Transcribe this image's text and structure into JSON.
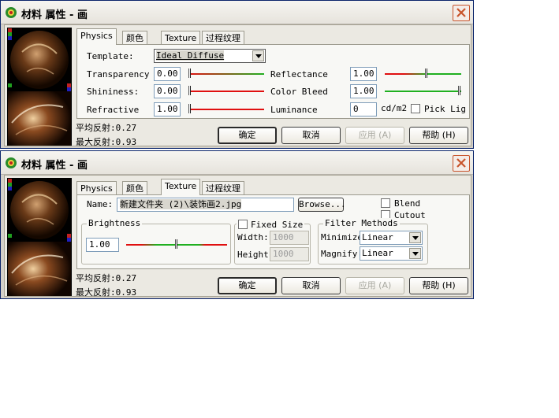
{
  "window_title": "材料  属性 - 画",
  "close_label": "×",
  "tabs": [
    "Physics",
    "颜色",
    "Texture",
    "过程纹理"
  ],
  "physics": {
    "template_label": "Template:",
    "template_value": "Ideal Diffuse",
    "transparency_label": "Transparency",
    "transparency_value": "0.00",
    "shininess_label": "Shininess:",
    "shininess_value": "0.00",
    "refractive_label": "Refractive",
    "refractive_value": "1.00",
    "reflectance_label": "Reflectance",
    "reflectance_value": "1.00",
    "color_bleed_label": "Color Bleed",
    "color_bleed_value": "1.00",
    "luminance_label": "Luminance",
    "luminance_value": "0",
    "luminance_unit": "cd/m2",
    "pick_light_label": "Pick Lig",
    "slider_levels": {
      "transparency": 0.0,
      "shininess": 0.0,
      "refractive": 0.0,
      "reflectance": 0.55,
      "color_bleed": 1.0
    }
  },
  "texture": {
    "name_label": "Name:",
    "name_value": "新建文件夹 (2)\\装饰画2.jpg",
    "browse_label": "Browse...",
    "blend_label": "Blend",
    "cutout_label": "Cutout",
    "brightness_title": "Brightness",
    "brightness_value": "1.00",
    "brightness_level": 0.5,
    "fixed_size_label": "Fixed Size",
    "width_label": "Width:",
    "width_value": "1000",
    "height_label": "Height",
    "height_value": "1000",
    "filter_title": "Filter Methods",
    "minimize_label": "Minimize",
    "minimize_value": "Linear",
    "magnify_label": "Magnify",
    "magnify_value": "Linear"
  },
  "stats": {
    "avg_reflect": "平均反射:0.27",
    "max_reflect": "最大反射:0.93"
  },
  "buttons": {
    "ok": "确定",
    "cancel": "取消",
    "apply": "应用 (A)",
    "help": "帮助 (H)"
  },
  "colors": {
    "accent": "#0a246a",
    "slider_red": "#e01010",
    "slider_green": "#20b020",
    "close_red": "#c8542c"
  }
}
